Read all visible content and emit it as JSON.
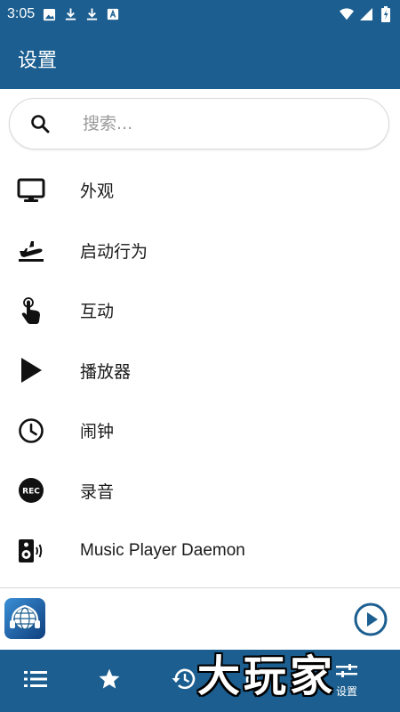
{
  "status_bar": {
    "time": "3:05",
    "left_icons": [
      "image-icon",
      "download-icon",
      "download-icon",
      "text-a-icon"
    ],
    "right_icons": [
      "wifi-icon",
      "signal-icon",
      "battery-charging-icon"
    ]
  },
  "app_bar": {
    "title": "设置"
  },
  "search": {
    "placeholder": "搜索..."
  },
  "menu": {
    "items": [
      {
        "label": "外观",
        "icon": "monitor-icon"
      },
      {
        "label": "启动行为",
        "icon": "airplane-takeoff-icon"
      },
      {
        "label": "互动",
        "icon": "touch-hand-icon"
      },
      {
        "label": "播放器",
        "icon": "play-icon"
      },
      {
        "label": "闹钟",
        "icon": "clock-icon"
      },
      {
        "label": "录音",
        "icon": "rec-icon"
      },
      {
        "label": "Music Player Daemon",
        "icon": "speaker-icon"
      }
    ]
  },
  "mini_player": {
    "logo_icon": "radio-globe-logo-icon",
    "play_icon": "play-circle-icon"
  },
  "bottom_nav": {
    "items": [
      {
        "icon": "list-icon"
      },
      {
        "icon": "star-icon"
      },
      {
        "icon": "history-icon"
      },
      {
        "icon": "alarm-icon"
      },
      {
        "icon": "settings-sliders-icon",
        "label": "设置"
      }
    ]
  },
  "watermark": "大玩家",
  "colors": {
    "primary": "#1b5e8f",
    "background": "#ffffff",
    "text": "#1a1a1a"
  }
}
